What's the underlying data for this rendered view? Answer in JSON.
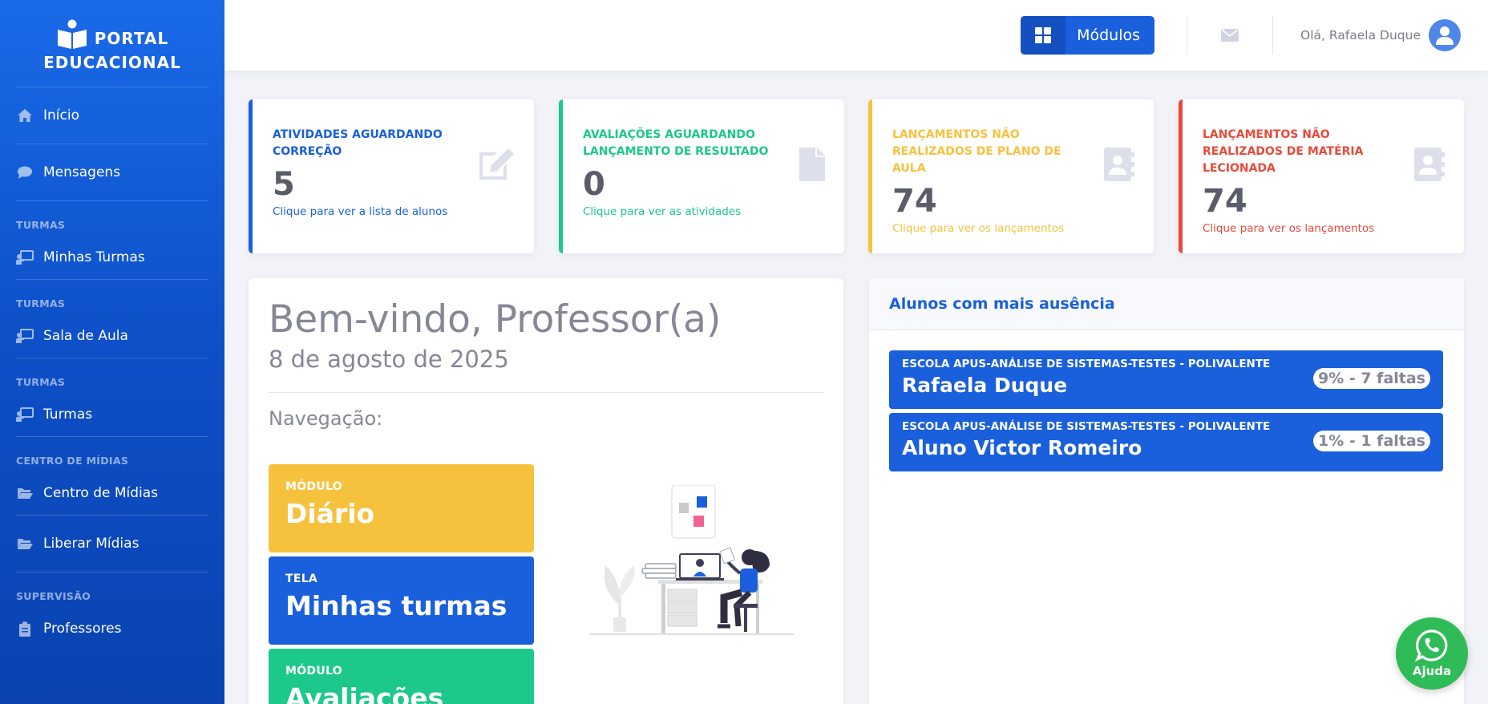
{
  "brand": {
    "line1": "PORTAL",
    "line2": "EDUCACIONAL"
  },
  "sidebar": {
    "inicio": "Início",
    "mensagens": "Mensagens",
    "heading_turmas_1": "TURMAS",
    "minhas_turmas": "Minhas Turmas",
    "heading_turmas_2": "TURMAS",
    "sala_de_aula": "Sala de Aula",
    "heading_turmas_3": "TURMAS",
    "turmas": "Turmas",
    "heading_midias": "CENTRO DE MÍDIAS",
    "centro_midias": "Centro de Mídias",
    "liberar_midias": "Liberar Mídias",
    "heading_supervisao": "SUPERVISÃO",
    "professores": "Professores"
  },
  "topbar": {
    "modulos_label": "Módulos",
    "greeting": "Olá, Rafaela Duque"
  },
  "stats": [
    {
      "title": "ATIVIDADES AGUARDANDO CORREÇÃO",
      "value": "5",
      "sub": "Clique para ver a lista de alunos",
      "color": "#1a5fdc",
      "icon": "edit-icon"
    },
    {
      "title": "AVALIAÇÕES AGUARDANDO LANÇAMENTO DE RESULTADO",
      "value": "0",
      "sub": "Clique para ver as atividades",
      "color": "#1cc88a",
      "icon": "file-icon"
    },
    {
      "title": "LANÇAMENTOS NÃO REALIZADOS DE PLANO DE AULA",
      "value": "74",
      "sub": "Clique para ver os lançamentos",
      "color": "#f6c23e",
      "icon": "address-book-icon"
    },
    {
      "title": "LANÇAMENTOS NÃO REALIZADOS DE MATÉRIA LECIONADA",
      "value": "74",
      "sub": "Clique para ver os lançamentos",
      "color": "#e74a3b",
      "icon": "address-book-icon"
    }
  ],
  "welcome": {
    "title": "Bem-vindo, Professor(a)",
    "date": "8 de agosto de 2025",
    "nav_label": "Navegação:",
    "tiles": [
      {
        "kind": "MÓDULO",
        "name": "Diário",
        "color": "#f6c23e"
      },
      {
        "kind": "TELA",
        "name": "Minhas turmas",
        "color": "#1a5fdc"
      },
      {
        "kind": "MÓDULO",
        "name": "Avaliações",
        "color": "#1cc88a"
      }
    ]
  },
  "absent": {
    "title": "Alunos com mais ausência",
    "rows": [
      {
        "school": "ESCOLA APUS-ANÁLISE DE SISTEMAS-TESTES - POLIVALENTE",
        "name": "Rafaela Duque",
        "pill": "9% - 7 faltas"
      },
      {
        "school": "ESCOLA APUS-ANÁLISE DE SISTEMAS-TESTES - POLIVALENTE",
        "name": "Aluno Victor Romeiro",
        "pill": "1% - 1 faltas"
      }
    ]
  },
  "help": {
    "label": "Ajuda"
  }
}
